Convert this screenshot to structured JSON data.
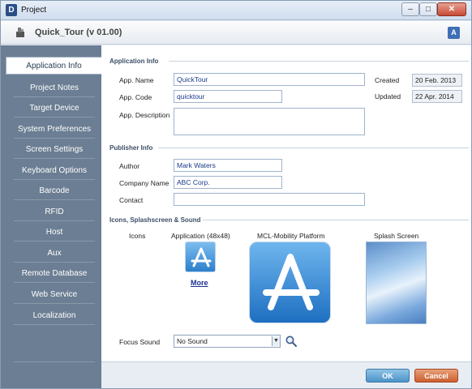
{
  "window": {
    "title": "Project",
    "app_icon": "D",
    "minimize_glyph": "–",
    "maximize_glyph": "□",
    "close_glyph": "✕"
  },
  "header": {
    "project_title": "Quick_Tour (v 01.00)",
    "translate_icon_text": "A"
  },
  "sidebar": {
    "items": [
      {
        "label": "Application Info",
        "active": true
      },
      {
        "label": "Project Notes"
      },
      {
        "label": "Target Device"
      },
      {
        "label": "System Preferences"
      },
      {
        "label": "Screen Settings"
      },
      {
        "label": "Keyboard Options"
      },
      {
        "label": "Barcode"
      },
      {
        "label": "RFID"
      },
      {
        "label": "Host"
      },
      {
        "label": "Aux"
      },
      {
        "label": "Remote Database"
      },
      {
        "label": "Web Service"
      },
      {
        "label": "Localization"
      }
    ]
  },
  "application_info": {
    "section_title": "Application Info",
    "app_name_label": "App. Name",
    "app_name_value": "QuickTour",
    "app_code_label": "App. Code",
    "app_code_value": "quicktour",
    "app_description_label": "App. Description",
    "app_description_value": "",
    "created_label": "Created",
    "created_value": "20 Feb. 2013",
    "updated_label": "Updated",
    "updated_value": "22 Apr. 2014"
  },
  "publisher_info": {
    "section_title": "Publisher Info",
    "author_label": "Author",
    "author_value": "Mark Waters",
    "company_label": "Company Name",
    "company_value": "ABC Corp.",
    "contact_label": "Contact",
    "contact_value": ""
  },
  "icons_section": {
    "section_title": "Icons, Splashscreen & Sound",
    "icons_label": "Icons",
    "application_label": "Application (48x48)",
    "platform_label": "MCL-Mobility Platform",
    "splash_label": "Splash Screen",
    "more_link": "More",
    "focus_sound_label": "Focus Sound",
    "focus_sound_value": "No Sound"
  },
  "footer": {
    "ok_label": "OK",
    "cancel_label": "Cancel"
  },
  "colors": {
    "sidebar_bg": "#6b7e93",
    "ok_button": "#4b93c8",
    "cancel_button": "#cc5f2f"
  }
}
